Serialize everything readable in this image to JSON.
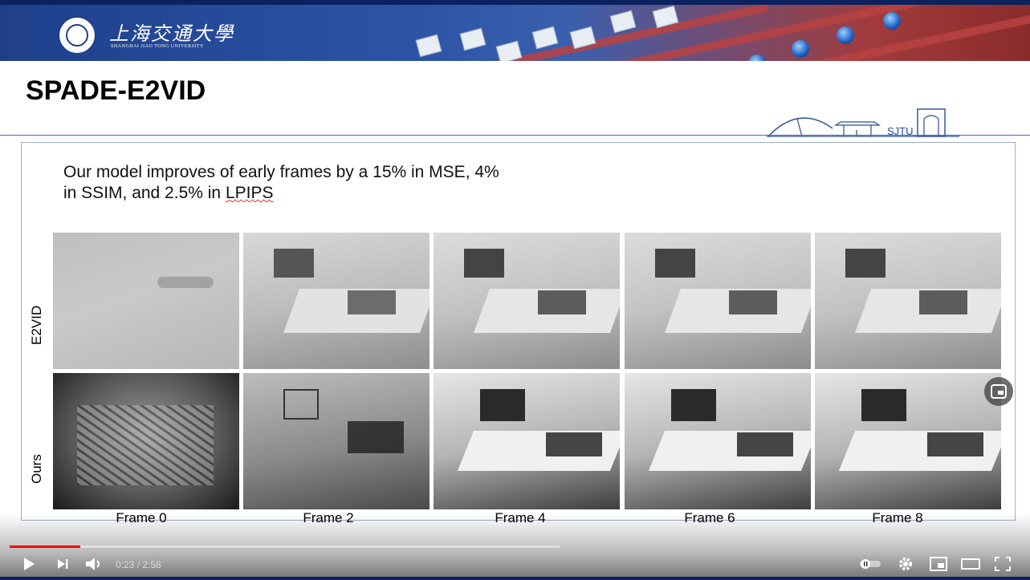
{
  "header": {
    "logo_cn": "上海交通大學",
    "logo_en": "SHANGHAI JIAO TONG UNIVERSITY",
    "landmark_text": "SJTU"
  },
  "slide": {
    "title": "SPADE-E2VID",
    "caption_line1": "Our model improves of early frames by a 15% in MSE, 4%",
    "caption_line2_prefix": "in SSIM, and 2.5% in ",
    "caption_line2_flagged": "LPIPS",
    "rows": [
      "E2VID",
      "Ours"
    ],
    "frames": [
      "Frame 0",
      "Frame 2",
      "Frame 4",
      "Frame 6",
      "Frame 8"
    ]
  },
  "player": {
    "time": "0:23 / 2:58",
    "progress": 0.129,
    "icons": [
      "play-icon",
      "next-icon",
      "volume-icon",
      "autoplay-toggle-icon",
      "settings-gear-icon",
      "miniplayer-icon",
      "theater-mode-icon",
      "fullscreen-icon",
      "cast-icon"
    ]
  },
  "colors": {
    "banner_blue": "#1f3f8a",
    "banner_red": "#a23b3b",
    "progress_red": "#ff0000"
  }
}
